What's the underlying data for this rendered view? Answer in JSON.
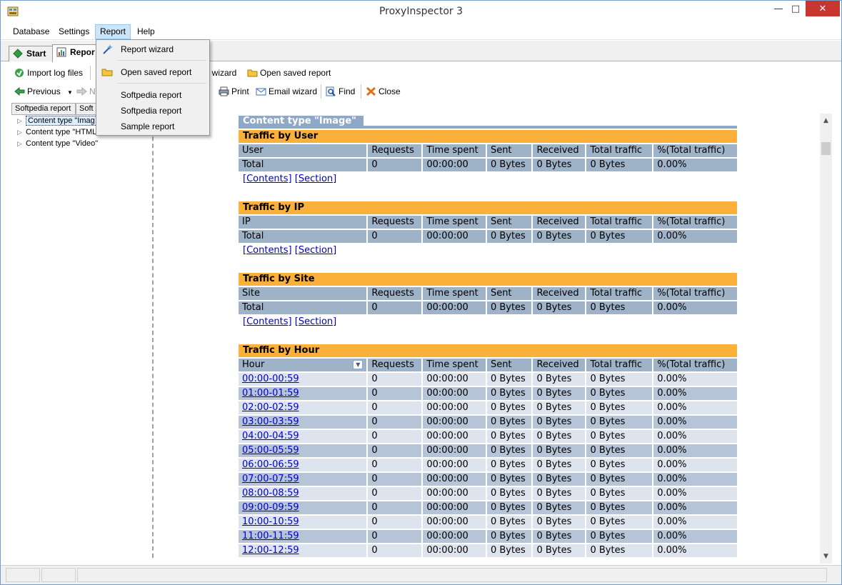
{
  "window": {
    "title": "ProxyInspector 3"
  },
  "menubar": {
    "items": [
      "Database",
      "Settings",
      "Report",
      "Help"
    ]
  },
  "tabs": [
    {
      "label": "Start"
    },
    {
      "label": "Repor"
    }
  ],
  "toolbar": {
    "import_log_files": "Import log files",
    "report_wizard_partial": "rt wizard",
    "open_saved_report": "Open saved report",
    "previous": "Previous",
    "next_partial": "N",
    "print": "Print",
    "email_wizard": "Email wizard",
    "find": "Find",
    "close": "Close"
  },
  "report_menu": {
    "items": [
      "Report wizard",
      "Open saved report",
      "Softpedia report",
      "Softpedia report",
      "Sample report"
    ]
  },
  "left_pane": {
    "tabs": [
      "Softpedia report",
      "Soft"
    ],
    "tree": [
      {
        "label": "Content type \"Imag",
        "selected": true
      },
      {
        "label": "Content type \"HTML"
      },
      {
        "label": "Content type \"Video\""
      }
    ]
  },
  "report": {
    "crumb": "Content type \"Image\"",
    "links": {
      "contents": "[Contents]",
      "section": "[Section]"
    },
    "sections": [
      {
        "title": "Traffic by User",
        "headers": [
          "User",
          "Requests",
          "Time spent",
          "Sent",
          "Received",
          "Total traffic",
          "%(Total traffic)"
        ],
        "rows": [
          [
            "Total",
            "0",
            "00:00:00",
            "0 Bytes",
            "0 Bytes",
            "0 Bytes",
            "0.00%"
          ]
        ]
      },
      {
        "title": "Traffic by IP",
        "headers": [
          "IP",
          "Requests",
          "Time spent",
          "Sent",
          "Received",
          "Total traffic",
          "%(Total traffic)"
        ],
        "rows": [
          [
            "Total",
            "0",
            "00:00:00",
            "0 Bytes",
            "0 Bytes",
            "0 Bytes",
            "0.00%"
          ]
        ]
      },
      {
        "title": "Traffic by Site",
        "headers": [
          "Site",
          "Requests",
          "Time spent",
          "Sent",
          "Received",
          "Total traffic",
          "%(Total traffic)"
        ],
        "rows": [
          [
            "Total",
            "0",
            "00:00:00",
            "0 Bytes",
            "0 Bytes",
            "0 Bytes",
            "0.00%"
          ]
        ]
      }
    ],
    "hour_section": {
      "title": "Traffic by Hour",
      "headers": [
        "Hour",
        "Requests",
        "Time spent",
        "Sent",
        "Received",
        "Total traffic",
        "%(Total traffic)"
      ],
      "rows": [
        [
          "00:00-00:59",
          "0",
          "00:00:00",
          "0 Bytes",
          "0 Bytes",
          "0 Bytes",
          "0.00%"
        ],
        [
          "01:00-01:59",
          "0",
          "00:00:00",
          "0 Bytes",
          "0 Bytes",
          "0 Bytes",
          "0.00%"
        ],
        [
          "02:00-02:59",
          "0",
          "00:00:00",
          "0 Bytes",
          "0 Bytes",
          "0 Bytes",
          "0.00%"
        ],
        [
          "03:00-03:59",
          "0",
          "00:00:00",
          "0 Bytes",
          "0 Bytes",
          "0 Bytes",
          "0.00%"
        ],
        [
          "04:00-04:59",
          "0",
          "00:00:00",
          "0 Bytes",
          "0 Bytes",
          "0 Bytes",
          "0.00%"
        ],
        [
          "05:00-05:59",
          "0",
          "00:00:00",
          "0 Bytes",
          "0 Bytes",
          "0 Bytes",
          "0.00%"
        ],
        [
          "06:00-06:59",
          "0",
          "00:00:00",
          "0 Bytes",
          "0 Bytes",
          "0 Bytes",
          "0.00%"
        ],
        [
          "07:00-07:59",
          "0",
          "00:00:00",
          "0 Bytes",
          "0 Bytes",
          "0 Bytes",
          "0.00%"
        ],
        [
          "08:00-08:59",
          "0",
          "00:00:00",
          "0 Bytes",
          "0 Bytes",
          "0 Bytes",
          "0.00%"
        ],
        [
          "09:00-09:59",
          "0",
          "00:00:00",
          "0 Bytes",
          "0 Bytes",
          "0 Bytes",
          "0.00%"
        ],
        [
          "10:00-10:59",
          "0",
          "00:00:00",
          "0 Bytes",
          "0 Bytes",
          "0 Bytes",
          "0.00%"
        ],
        [
          "11:00-11:59",
          "0",
          "00:00:00",
          "0 Bytes",
          "0 Bytes",
          "0 Bytes",
          "0.00%"
        ],
        [
          "12:00-12:59",
          "0",
          "00:00:00",
          "0 Bytes",
          "0 Bytes",
          "0 Bytes",
          "0.00%"
        ]
      ]
    }
  },
  "colors": {
    "section_header": "#fbb03b",
    "table_header": "#9eb2c8",
    "row_light": "#dde4ee",
    "row_dark": "#b5c4d6",
    "link": "#0000cc",
    "close_button": "#c7372f"
  }
}
